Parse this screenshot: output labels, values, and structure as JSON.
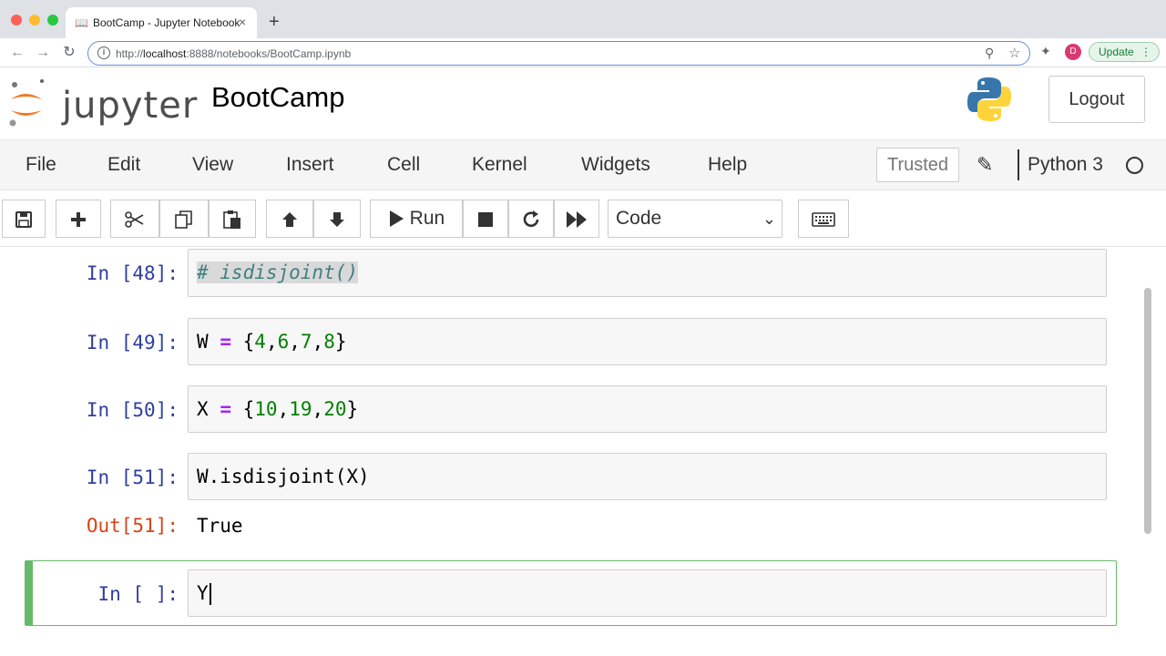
{
  "browser": {
    "tab_title": "BootCamp - Jupyter Notebook",
    "tab_close": "×",
    "new_tab": "+",
    "url_prefix": "http://",
    "url_host": "localhost",
    "url_rest": ":8888/notebooks/BootCamp.ipynb",
    "profile_initial": "D",
    "update_label": "Update"
  },
  "header": {
    "logo_text": "jupyter",
    "notebook_title": "BootCamp",
    "logout_label": "Logout"
  },
  "menu": {
    "items": [
      "File",
      "Edit",
      "View",
      "Insert",
      "Cell",
      "Kernel",
      "Widgets",
      "Help"
    ],
    "trusted_label": "Trusted",
    "kernel_name": "Python 3"
  },
  "toolbar": {
    "run_label": "Run",
    "cell_type": "Code"
  },
  "cells": [
    {
      "prompt": "In [48]:",
      "code": "# isdisjoint()"
    },
    {
      "prompt": "In [49]:",
      "code_var": "W",
      "code_op": "=",
      "code_open": "{",
      "code_nums": [
        "4",
        "6",
        "7",
        "8"
      ],
      "code_close": "}"
    },
    {
      "prompt": "In [50]:",
      "code_var": "X",
      "code_op": "=",
      "code_open": "{",
      "code_nums": [
        "10",
        "19",
        "20"
      ],
      "code_close": "}"
    },
    {
      "prompt": "In [51]:",
      "code": "W.isdisjoint(X)",
      "out_prompt": "Out[51]:",
      "output": "True"
    },
    {
      "prompt": "In [ ]:",
      "code": "Y"
    }
  ],
  "colors": {
    "input_prompt": "#303f9f",
    "output_prompt": "#d84315",
    "selected_border": "#66bb6a"
  }
}
